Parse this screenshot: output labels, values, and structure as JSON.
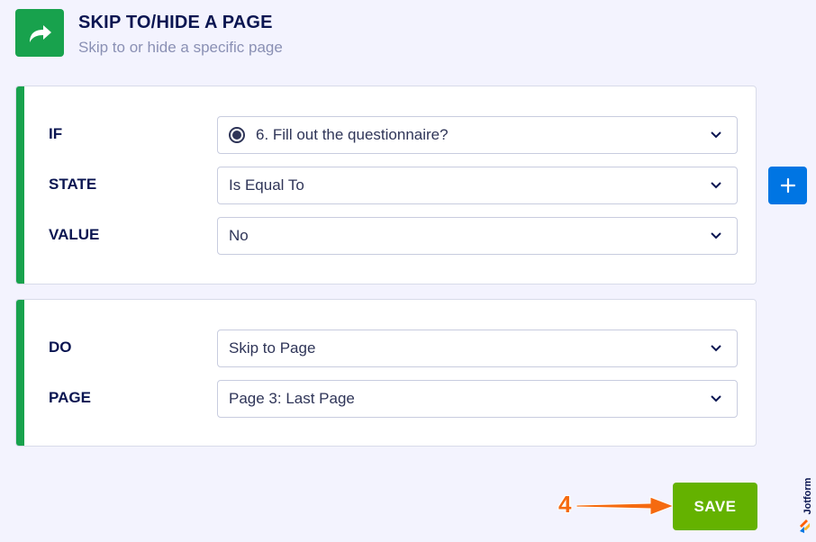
{
  "header": {
    "title": "SKIP TO/HIDE A PAGE",
    "subtitle": "Skip to or hide a specific page",
    "icon": "share-arrow-icon",
    "icon_color": "#18a24d"
  },
  "condition": {
    "if": {
      "label": "IF",
      "value": "6. Fill out the questionnaire?"
    },
    "state": {
      "label": "STATE",
      "value": "Is Equal To"
    },
    "value": {
      "label": "VALUE",
      "value": "No"
    }
  },
  "action": {
    "do": {
      "label": "DO",
      "value": "Skip to Page"
    },
    "page": {
      "label": "PAGE",
      "value": "Page 3: Last Page"
    }
  },
  "add_button": {
    "icon": "plus-icon",
    "color": "#0075e3"
  },
  "save_button": {
    "label": "SAVE",
    "color": "#64b200"
  },
  "annotation": {
    "step": "4",
    "color": "#f56a10"
  },
  "brand": {
    "name": "Jotform"
  }
}
